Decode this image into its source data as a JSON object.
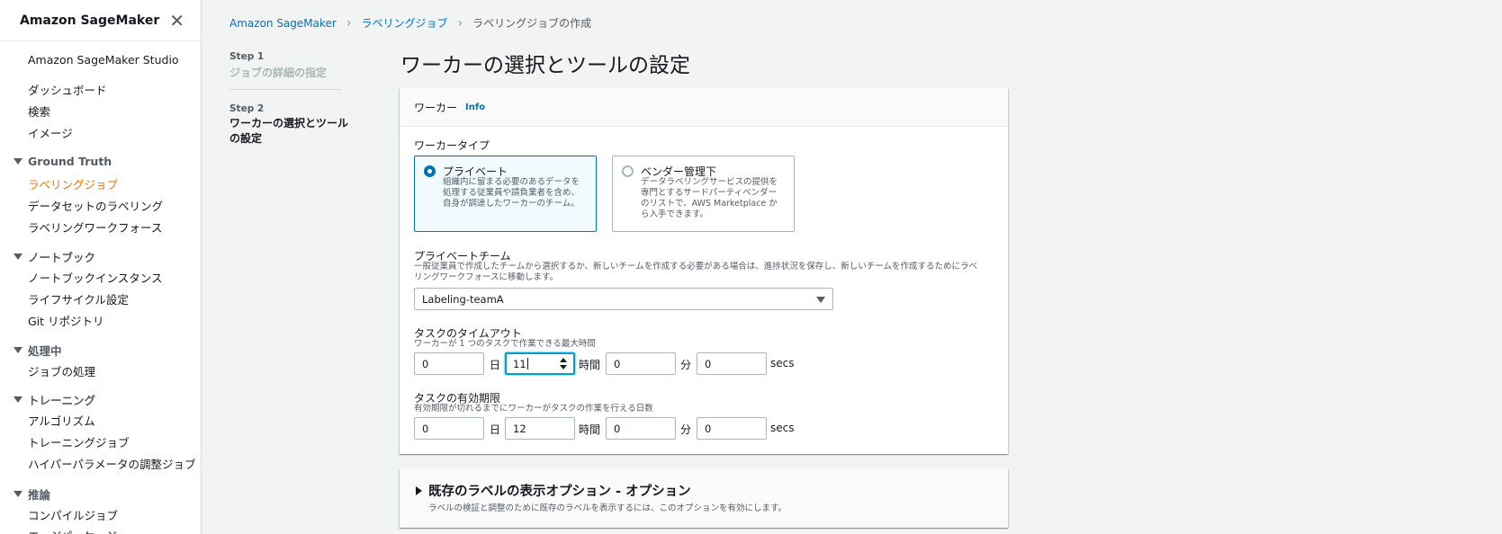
{
  "sidebar": {
    "title": "Amazon SageMaker",
    "studio": "Amazon SageMaker Studio",
    "top_items": [
      "ダッシュボード",
      "検索",
      "イメージ"
    ],
    "sections": [
      {
        "label": "Ground Truth",
        "items": [
          "ラベリングジョブ",
          "データセットのラベリング",
          "ラベリングワークフォース"
        ]
      },
      {
        "label": "ノートブック",
        "items": [
          "ノートブックインスタンス",
          "ライフサイクル設定",
          "Git リポジトリ"
        ]
      },
      {
        "label": "処理中",
        "items": [
          "ジョブの処理"
        ]
      },
      {
        "label": "トレーニング",
        "items": [
          "アルゴリズム",
          "トレーニングジョブ",
          "ハイパーパラメータの調整ジョブ"
        ]
      },
      {
        "label": "推論",
        "items": [
          "コンパイルジョブ",
          "エッジパッケージ"
        ]
      }
    ],
    "active_item": "ラベリングジョブ"
  },
  "breadcrumb": [
    "Amazon SageMaker",
    "ラベリングジョブ",
    "ラベリングジョブの作成"
  ],
  "steps": [
    {
      "label": "Step 1",
      "title": "ジョブの詳細の指定"
    },
    {
      "label": "Step 2",
      "title": "ワーカーの選択とツールの設定"
    }
  ],
  "page_title": "ワーカーの選択とツールの設定",
  "workers_panel": {
    "header": "ワーカー",
    "info": "Info",
    "worker_type_label": "ワーカータイプ",
    "options": [
      {
        "title": "プライベート",
        "desc": "組織内に留まる必要のあるデータを処理する従業員や請負業者を含め、自身が調達したワーカーのチーム。",
        "selected": true
      },
      {
        "title": "ベンダー管理下",
        "desc": "データラベリングサービスの提供を専門とするサードパーティベンダーのリストで、AWS Marketplace から入手できます。",
        "selected": false
      }
    ],
    "private_team_label": "プライベートチーム",
    "private_team_desc": "一般従業員で作成したチームから選択するか、新しいチームを作成する必要がある場合は、進捗状況を保存し、新しいチームを作成するためにラベリングワークフォースに移動します。",
    "private_team_value": "Labeling-teamA",
    "timeout": {
      "label": "タスクのタイムアウト",
      "desc": "ワーカーが 1 つのタスクで作業できる最大時間",
      "days": "0",
      "hours": "11",
      "minutes": "0",
      "seconds": "0"
    },
    "expiry": {
      "label": "タスクの有効期限",
      "desc": "有効期限が切れるまでにワーカーがタスクの作業を行える日数",
      "days": "0",
      "hours": "12",
      "minutes": "0",
      "seconds": "0"
    },
    "units": {
      "day": "日",
      "hour": "時間",
      "minute": "分",
      "second": "secs"
    }
  },
  "label_options_panel": {
    "title": "既存のラベルの表示オプション - オプション",
    "desc": "ラベルの検証と調整のために既存のラベルを表示するには、このオプションを有効にします。"
  }
}
